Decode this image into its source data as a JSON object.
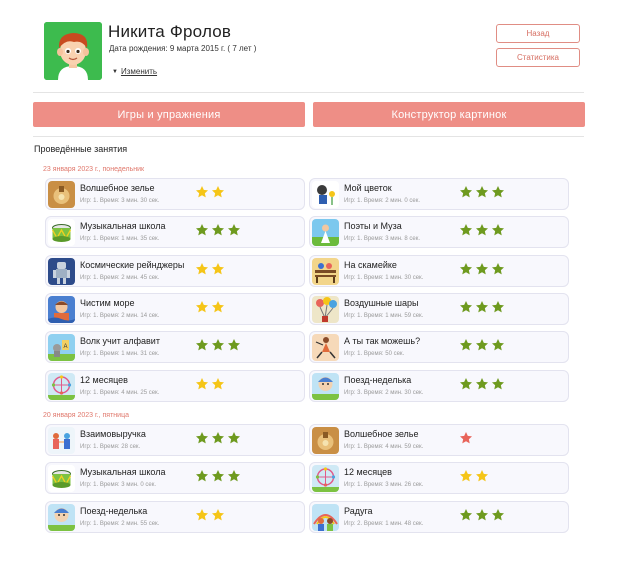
{
  "profile": {
    "name": "Никита Фролов",
    "birth": "Дата рождения: 9 марта 2015 г. ( 7 лет )",
    "edit_label": "Изменить"
  },
  "buttons": {
    "back": "Назад",
    "stats": "Статистика",
    "games": "Игры и упражнения",
    "constructor": "Конструктор картинок"
  },
  "section_title": "Проведённые занятия",
  "colors": {
    "accent": "#ee8e86",
    "accent_text": "#d66e62",
    "star_green": "#6e9a1f",
    "star_yellow": "#f5c518",
    "star_red": "#e8645a"
  },
  "sessions": [
    {
      "date": "23 января 2023 г., понедельник",
      "left": [
        {
          "title": "Волшебное зелье",
          "stats": "Игр: 1. Время: 3 мин. 30 сек.",
          "stars": 2,
          "icon": "magic-potion-icon"
        },
        {
          "title": "Музыкальная школа",
          "stats": "Игр: 1. Время: 1 мин. 35 сек.",
          "stars": 3,
          "icon": "drum-icon"
        },
        {
          "title": "Космические рейнджеры",
          "stats": "Игр: 1. Время: 2 мин. 45 сек.",
          "stars": 2,
          "icon": "robot-icon"
        },
        {
          "title": "Чистим море",
          "stats": "Игр: 1. Время: 2 мин. 14 сек.",
          "stars": 2,
          "icon": "sea-icon"
        },
        {
          "title": "Волк учит алфавит",
          "stats": "Игр: 1. Время: 1 мин. 31 сек.",
          "stars": 3,
          "icon": "wolf-icon"
        },
        {
          "title": "12 месяцев",
          "stats": "Игр: 1. Время: 4 мин. 25 сек.",
          "stars": 2,
          "icon": "ferris-wheel-icon"
        }
      ],
      "right": [
        {
          "title": "Мой цветок",
          "stats": "Игр: 1. Время: 2 мин. 0 сек.",
          "stars": 3,
          "icon": "flower-icon"
        },
        {
          "title": "Поэты и Муза",
          "stats": "Игр: 1. Время: 3 мин. 8 сек.",
          "stars": 3,
          "icon": "muse-icon"
        },
        {
          "title": "На скамейке",
          "stats": "Игр: 1. Время: 1 мин. 30 сек.",
          "stars": 3,
          "icon": "bench-icon"
        },
        {
          "title": "Воздушные шары",
          "stats": "Игр: 1. Время: 1 мин. 59 сек.",
          "stars": 3,
          "icon": "balloons-icon"
        },
        {
          "title": "А ты так можешь?",
          "stats": "Игр: 1. Время: 50 сек.",
          "stars": 3,
          "icon": "gymnast-icon"
        },
        {
          "title": "Поезд-неделька",
          "stats": "Игр: 3. Время: 2 мин. 30 сек.",
          "stars": 3,
          "icon": "train-icon"
        }
      ]
    },
    {
      "date": "20 января 2023 г., пятница",
      "left": [
        {
          "title": "Взаимовыручка",
          "stats": "Игр: 1. Время: 28 сек.",
          "stars": 3,
          "icon": "teamwork-icon"
        },
        {
          "title": "Музыкальная школа",
          "stats": "Игр: 1. Время: 3 мин. 0 сек.",
          "stars": 3,
          "icon": "drum-icon"
        },
        {
          "title": "Поезд-неделька",
          "stats": "Игр: 1. Время: 2 мин. 55 сек.",
          "stars": 2,
          "icon": "train-icon"
        }
      ],
      "right": [
        {
          "title": "Волшебное зелье",
          "stats": "Игр: 1. Время: 4 мин. 59 сек.",
          "stars": 1,
          "icon": "magic-potion-icon"
        },
        {
          "title": "12 месяцев",
          "stats": "Игр: 1. Время: 3 мин. 26 сек.",
          "stars": 2,
          "icon": "ferris-wheel-icon"
        },
        {
          "title": "Радуга",
          "stats": "Игр: 2. Время: 1 мин. 48 сек.",
          "stars": 3,
          "icon": "rainbow-icon"
        }
      ]
    }
  ]
}
